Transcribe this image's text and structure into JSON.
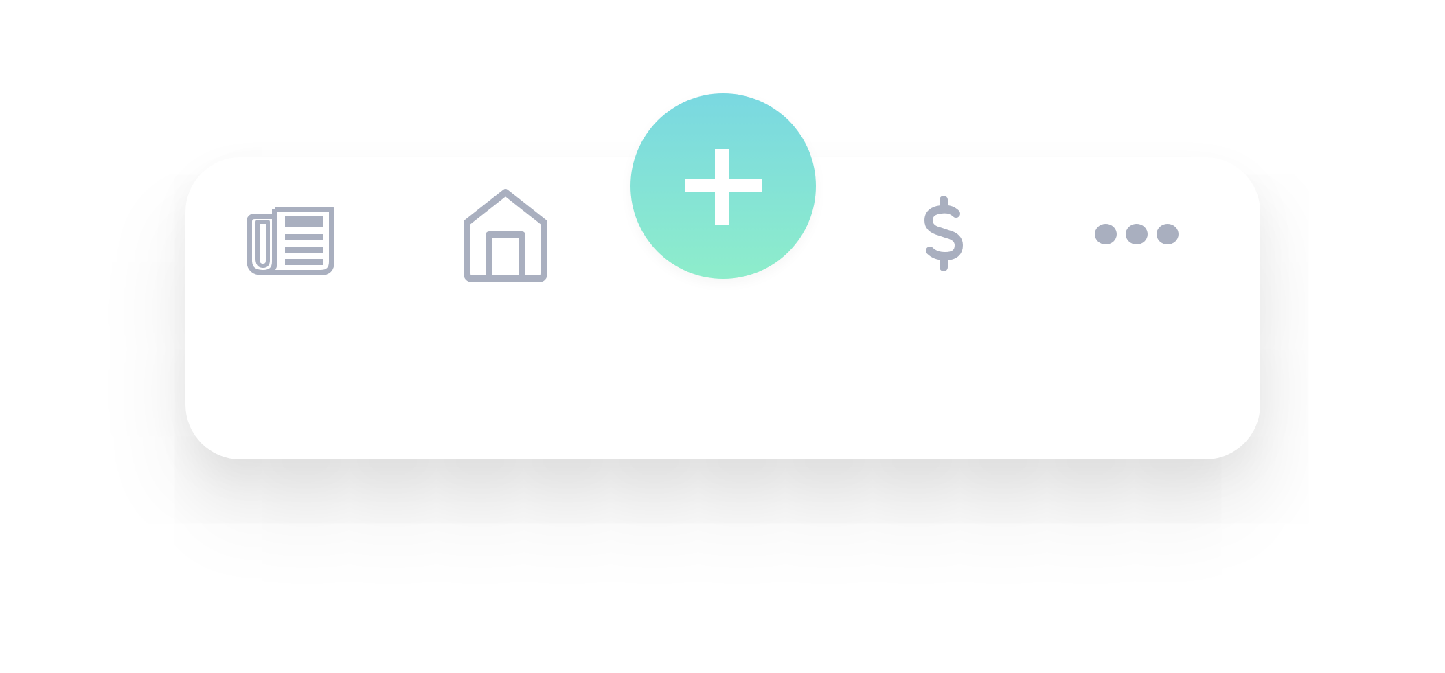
{
  "tab_bar": {
    "items": [
      {
        "id": "news",
        "icon": "newspaper-icon"
      },
      {
        "id": "home",
        "icon": "home-icon"
      },
      {
        "id": "add",
        "icon": "plus-icon"
      },
      {
        "id": "money",
        "icon": "dollar-icon"
      },
      {
        "id": "more",
        "icon": "more-horizontal-icon"
      }
    ]
  },
  "colors": {
    "icon_gray": "#a9afbf",
    "fab_gradient_top": "#7ad8e1",
    "fab_gradient_bottom": "#8eedcb",
    "fab_icon": "#ffffff",
    "bar_background": "#ffffff"
  }
}
